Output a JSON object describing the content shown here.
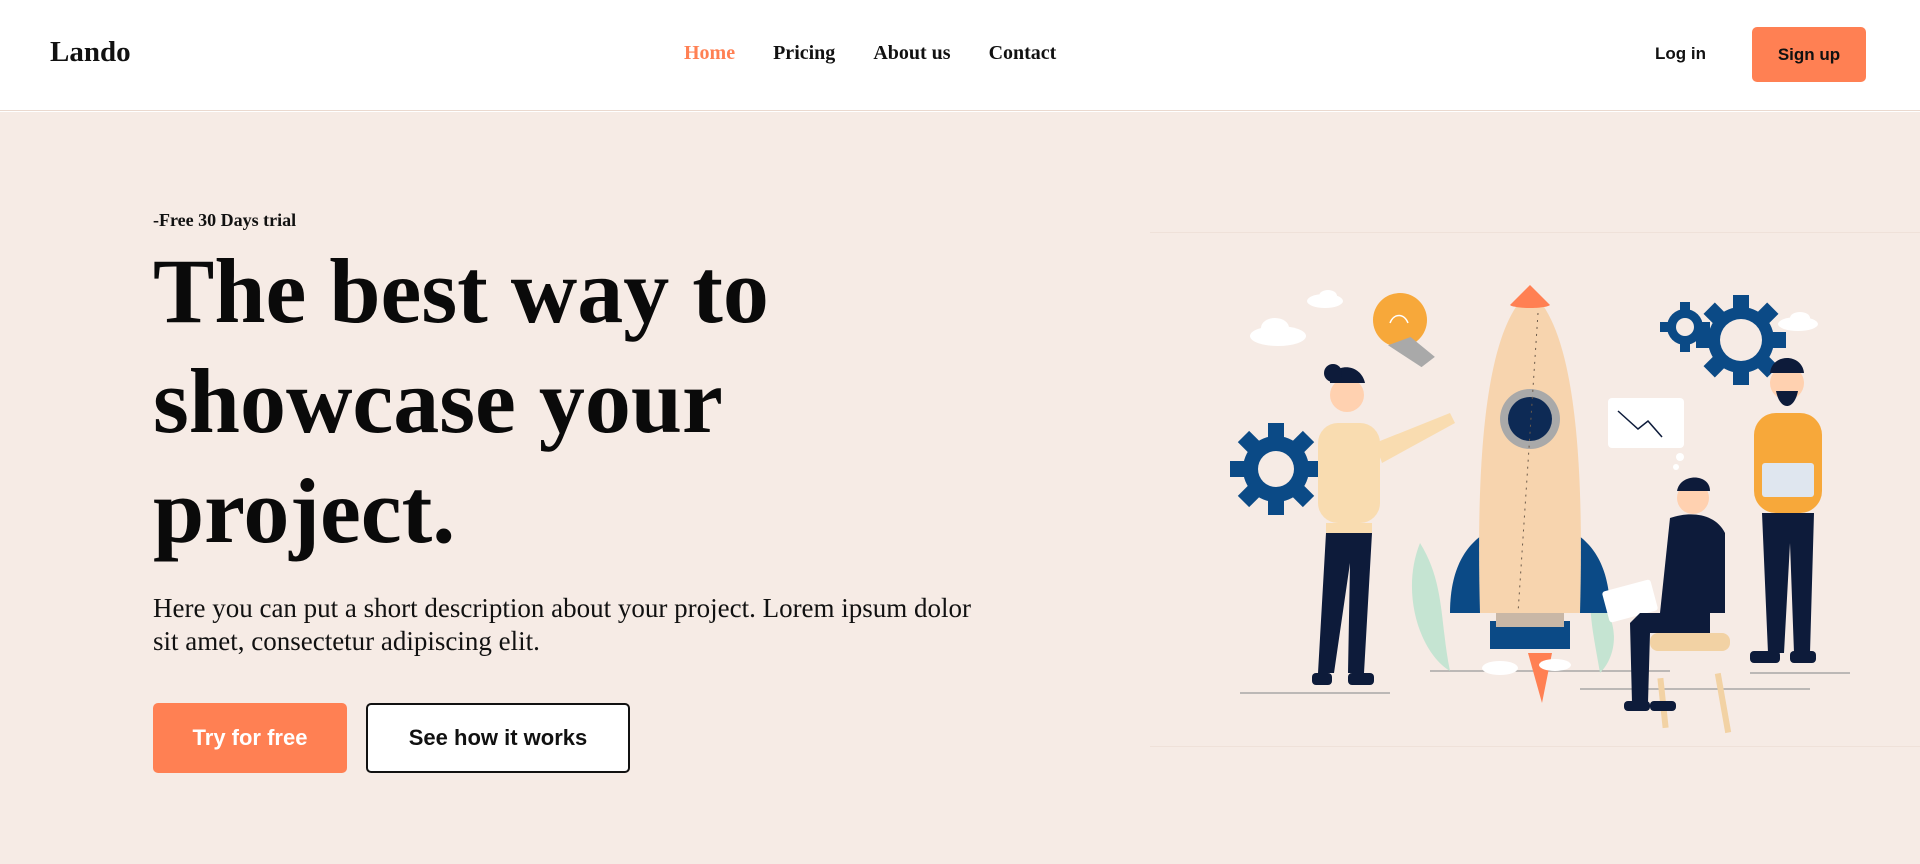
{
  "header": {
    "logo": "Lando",
    "nav": [
      "Home",
      "Pricing",
      "About us",
      "Contact"
    ],
    "active_nav": "Home",
    "login_label": "Log in",
    "signup_label": "Sign up"
  },
  "hero": {
    "eyebrow": "-Free 30 Days trial",
    "headline_lines": [
      "The best way to",
      "showcase your",
      "project."
    ],
    "description": "Here you can put a short description about your project. Lorem ipsum dolor sit amet, consectetur adipiscing elit.",
    "primary_cta": "Try for free",
    "secondary_cta": "See how it works"
  },
  "illustration": {
    "icon": "startup-launch-illustration"
  },
  "colors": {
    "accent": "#ff8053",
    "hero_bg": "#f6ebe5",
    "navy": "#0b4a86",
    "dark_navy": "#0d1b3a",
    "bulb_yellow": "#f7a83a"
  }
}
